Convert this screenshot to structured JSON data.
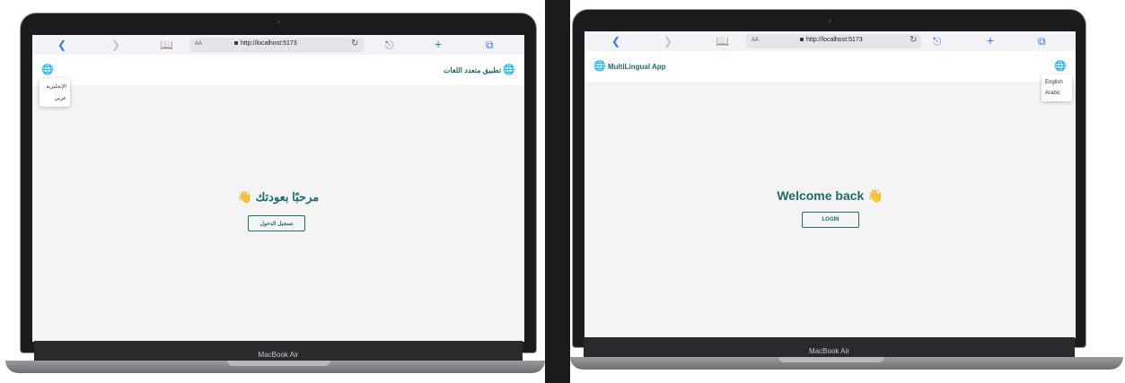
{
  "browser": {
    "url": "http://localhost:5173",
    "aa_label": "AA",
    "icons": [
      "back-icon",
      "forward-icon",
      "bookmarks-icon",
      "reload-icon",
      "share-icon",
      "new-tab-icon",
      "tabs-icon"
    ]
  },
  "laptop_label": "MacBook Air",
  "arabic": {
    "app_title": "تطبيق متعدد اللغات",
    "menu_items": [
      "الإنجليزية",
      "عربي"
    ],
    "welcome": "مرحبًا بعودتك",
    "login": "تسجيل الدخول"
  },
  "english": {
    "app_title": "MultiLingual App",
    "menu_items": [
      "English",
      "Arabic"
    ],
    "welcome": "Welcome back",
    "login": "LOGIN"
  },
  "icons": {
    "globe": "globe-icon",
    "wave": "waving-hand-icon"
  },
  "colors": {
    "brand": "#1f6b6b",
    "page_bg": "#f4f4f4",
    "browser_accent": "#3478f6"
  }
}
